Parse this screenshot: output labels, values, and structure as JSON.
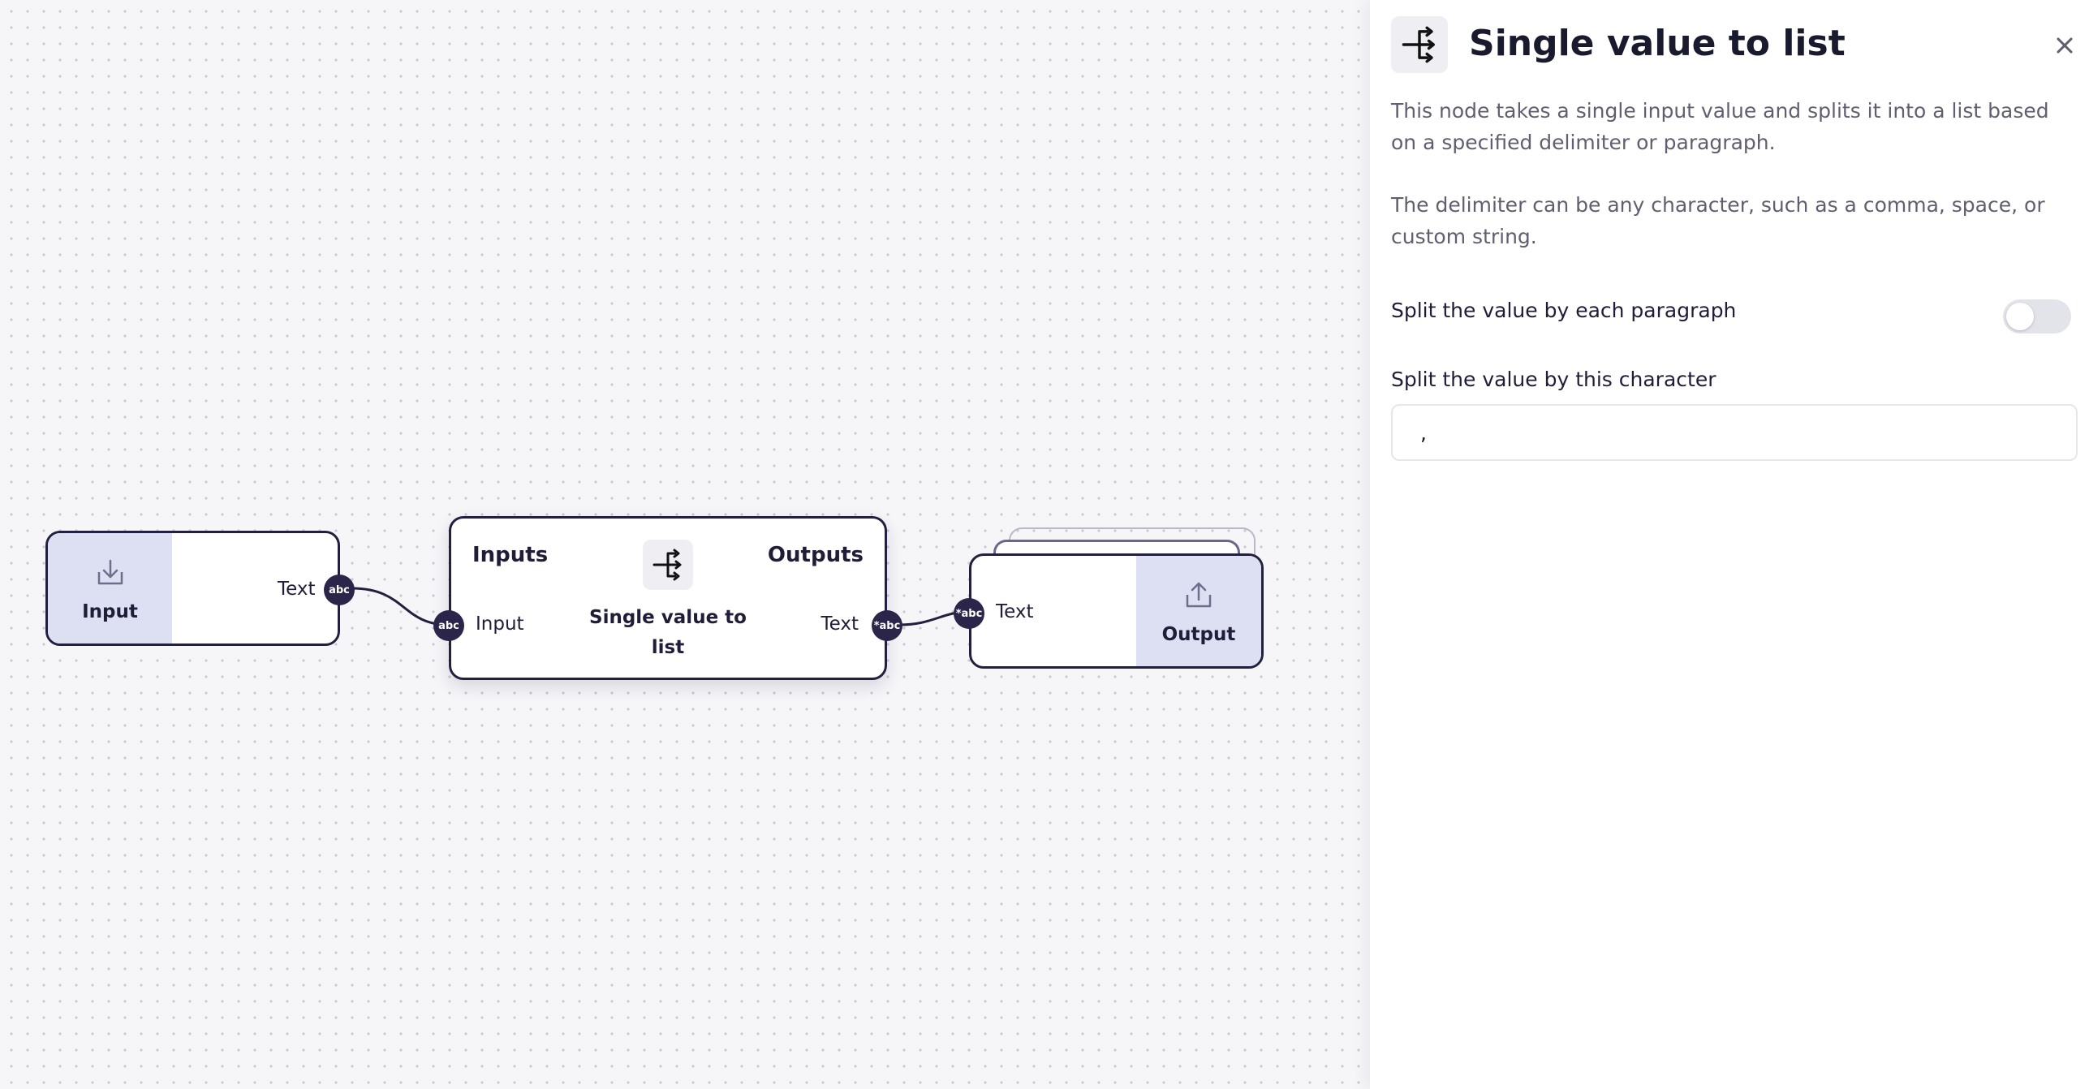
{
  "canvas": {
    "nodes": {
      "input": {
        "label": "Input",
        "icon": "import-icon",
        "output_port": {
          "label": "Text",
          "type": "abc"
        }
      },
      "main": {
        "inputs_title": "Inputs",
        "outputs_title": "Outputs",
        "title": "Single value to list",
        "icon": "split-icon",
        "input_port": {
          "label": "Input",
          "type": "abc"
        },
        "output_port": {
          "label": "Text",
          "type": "*abc"
        }
      },
      "output": {
        "label": "Output",
        "icon": "export-icon",
        "input_port": {
          "label": "Text",
          "type": "*abc"
        }
      }
    }
  },
  "panel": {
    "title": "Single value to list",
    "icon": "split-icon",
    "description_1": "This node takes a single input value and splits it into a list based on a specified delimiter or paragraph.",
    "description_2": "The delimiter can be any character, such as a comma, space, or custom string.",
    "toggle_label": "Split the value by each paragraph",
    "toggle_on": false,
    "character_label": "Split the value by this character",
    "character_value": ","
  },
  "colors": {
    "node_border": "#23203f",
    "port_fill": "#2a2549",
    "io_badge_bg": "#dde0f3",
    "canvas_bg": "#f6f6f9"
  }
}
